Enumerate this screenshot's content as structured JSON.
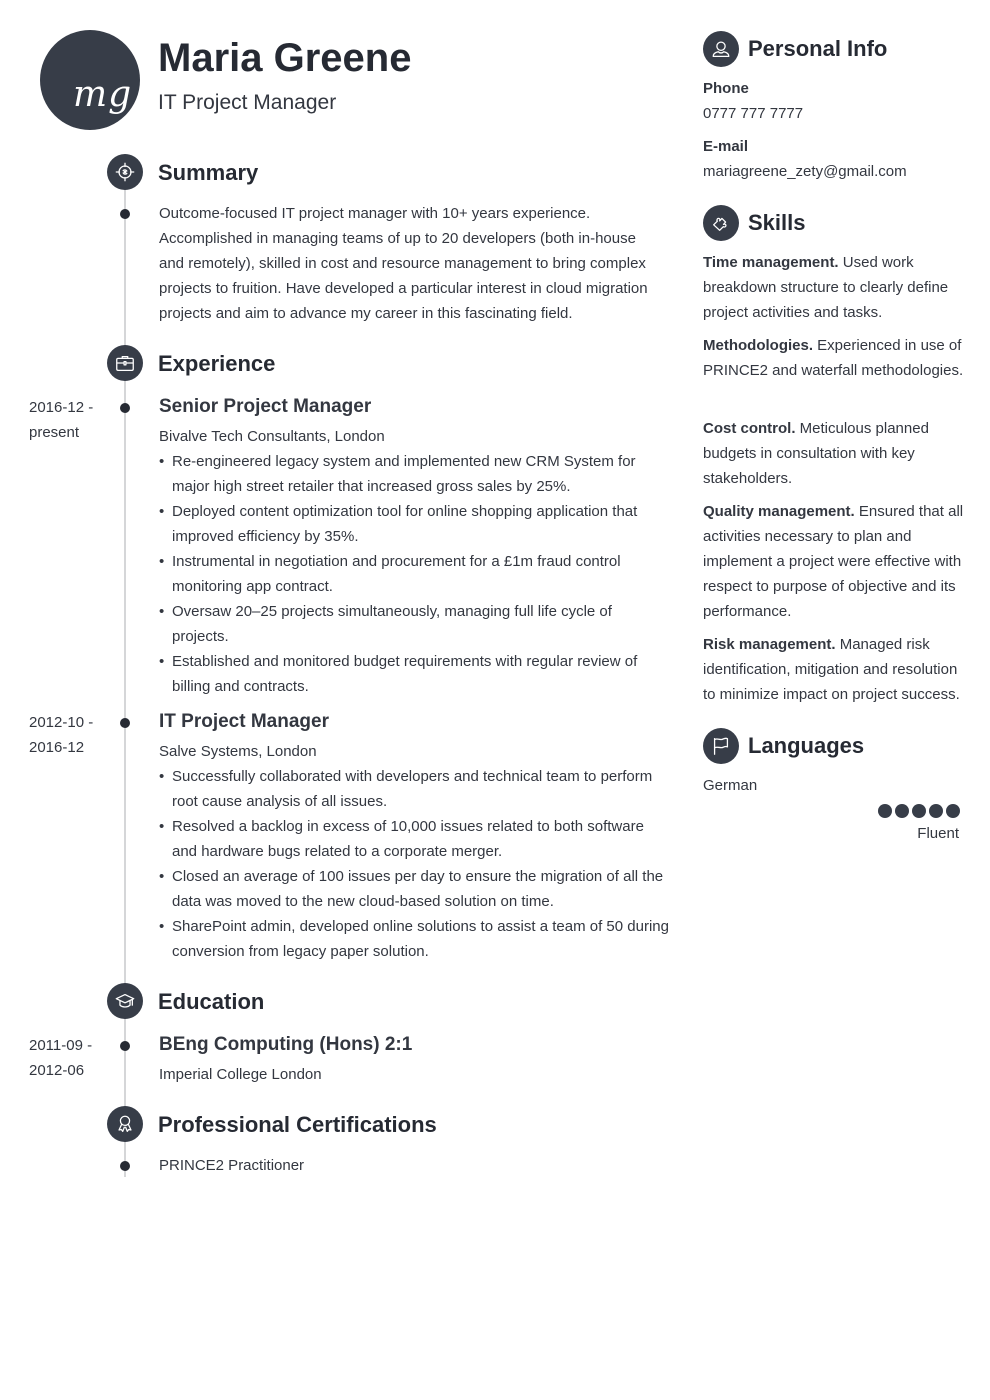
{
  "header": {
    "monogram": "mg",
    "name": "Maria Greene",
    "job_title": "IT Project Manager"
  },
  "theme": {
    "accent": "#373d48",
    "text": "#333740",
    "heading": "#262a33",
    "timeline": "#d5d6d8"
  },
  "summary": {
    "title": "Summary",
    "icon": "target-icon",
    "text": "Outcome-focused IT project manager with 10+ years experience. Accomplished in managing teams of up to 20 developers (both in-house and remotely), skilled in cost and resource management to bring complex projects to fruition. Have developed a particular interest in cloud migration projects and aim to advance my career in this fascinating field."
  },
  "experience": {
    "title": "Experience",
    "icon": "briefcase-icon",
    "jobs": [
      {
        "date_start": "2016-12 -",
        "date_end": "present",
        "title": "Senior Project Manager",
        "company": "Bivalve Tech Consultants, London",
        "bullets": [
          "Re-engineered legacy system and implemented new CRM System for major high street retailer that increased gross sales by 25%.",
          "Deployed content optimization tool for online shopping application that improved efficiency by 35%.",
          "Instrumental in negotiation and procurement for a £1m fraud control monitoring app contract.",
          "Oversaw 20–25 projects simultaneously, managing full life cycle of projects.",
          "Established and monitored budget requirements with regular review of billing and contracts."
        ]
      },
      {
        "date_start": "2012-10 -",
        "date_end": "2016-12",
        "title": "IT Project Manager",
        "company": "Salve Systems, London",
        "bullets": [
          "Successfully collaborated with developers and technical team to perform root cause analysis of all issues.",
          "Resolved a backlog in excess of 10,000 issues related to both software and hardware bugs related to a corporate merger.",
          "Closed an average of 100 issues per day to ensure the migration of all the data was moved to the new cloud-based solution on time.",
          "SharePoint admin, developed online solutions to assist a team of 50 during conversion from legacy paper solution."
        ]
      }
    ]
  },
  "education": {
    "title": "Education",
    "icon": "graduation-cap-icon",
    "items": [
      {
        "date_start": "2011-09 -",
        "date_end": "2012-06",
        "degree": "BEng Computing (Hons) 2:1",
        "school": "Imperial College London"
      }
    ]
  },
  "certifications": {
    "title": "Professional Certifications",
    "icon": "award-ribbon-icon",
    "items": [
      "PRINCE2 Practitioner"
    ]
  },
  "personal_info": {
    "title": "Personal Info",
    "icon": "user-icon",
    "phone_label": "Phone",
    "phone": "0777 777 7777",
    "email_label": "E-mail",
    "email": "mariagreene_zety@gmail.com"
  },
  "skills": {
    "title": "Skills",
    "icon": "puzzle-piece-icon",
    "items": [
      {
        "name": "Time management.",
        "desc": "Used work breakdown structure to clearly define project activities and tasks."
      },
      {
        "name": "Methodologies.",
        "desc": "Experienced in use of PRINCE2 and waterfall methodologies."
      },
      {
        "name": "Cost control.",
        "desc": "Meticulous planned budgets in consultation with key stakeholders."
      },
      {
        "name": "Quality management.",
        "desc": "Ensured that all activities necessary to plan and implement a project were effective with respect to purpose of objective and its performance."
      },
      {
        "name": "Risk management.",
        "desc": "Managed risk identification, mitigation and resolution to minimize impact on project success."
      }
    ]
  },
  "languages": {
    "title": "Languages",
    "icon": "flag-icon",
    "items": [
      {
        "name": "German",
        "level_label": "Fluent",
        "rating": 5,
        "rating_max": 5
      }
    ]
  }
}
